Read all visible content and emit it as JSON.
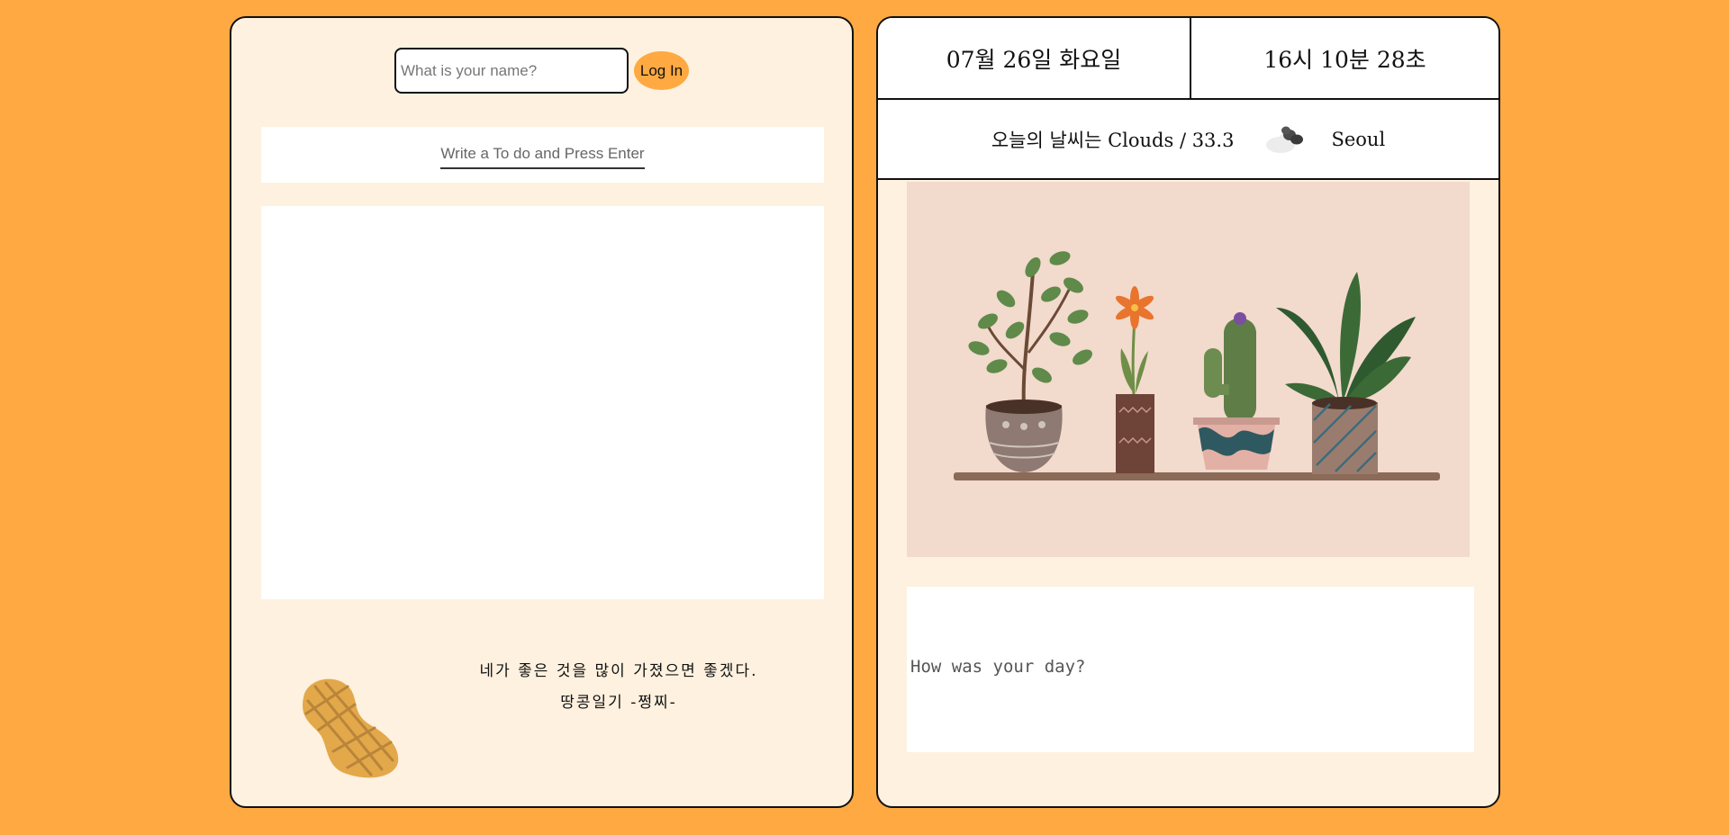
{
  "login": {
    "name_placeholder": "What is your name?",
    "button_label": "Log In"
  },
  "todo": {
    "input_placeholder": "Write a To do and Press Enter",
    "items": []
  },
  "quote": {
    "line1": "네가 좋은 것을 많이 가졌으면 좋겠다.",
    "line2": "땅콩일기 -쩡찌-"
  },
  "clock": {
    "date": "07월 26일 화요일",
    "time": "16시 10분 28초"
  },
  "weather": {
    "summary": "오늘의 날씨는 Clouds / 33.3",
    "icon": "broken-clouds-icon",
    "city": "Seoul"
  },
  "diary": {
    "placeholder": "How was your day?"
  },
  "colors": {
    "page_background": "#fea941",
    "panel_background": "#fef1df",
    "accent": "#fea941",
    "image_background": "#f2dacd"
  }
}
